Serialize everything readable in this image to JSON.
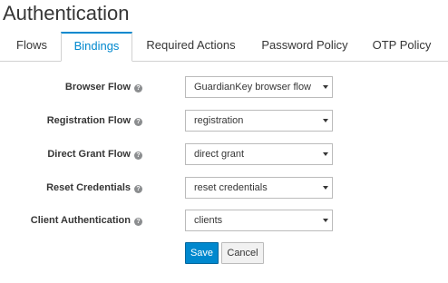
{
  "page": {
    "title": "Authentication"
  },
  "tabs": [
    {
      "label": "Flows",
      "active": false
    },
    {
      "label": "Bindings",
      "active": true
    },
    {
      "label": "Required Actions",
      "active": false
    },
    {
      "label": "Password Policy",
      "active": false
    },
    {
      "label": "OTP Policy",
      "active": false
    }
  ],
  "form": {
    "rows": [
      {
        "label": "Browser Flow",
        "value": "GuardianKey browser flow",
        "help_icon": "question-circle-icon"
      },
      {
        "label": "Registration Flow",
        "value": "registration",
        "help_icon": "question-circle-icon"
      },
      {
        "label": "Direct Grant Flow",
        "value": "direct grant",
        "help_icon": "question-circle-icon"
      },
      {
        "label": "Reset Credentials",
        "value": "reset credentials",
        "help_icon": "question-circle-icon"
      },
      {
        "label": "Client Authentication",
        "value": "clients",
        "help_icon": "question-circle-icon"
      }
    ],
    "save_label": "Save",
    "cancel_label": "Cancel"
  },
  "colors": {
    "accent": "#0088ce",
    "text": "#363636",
    "border": "#bbbbbb"
  }
}
